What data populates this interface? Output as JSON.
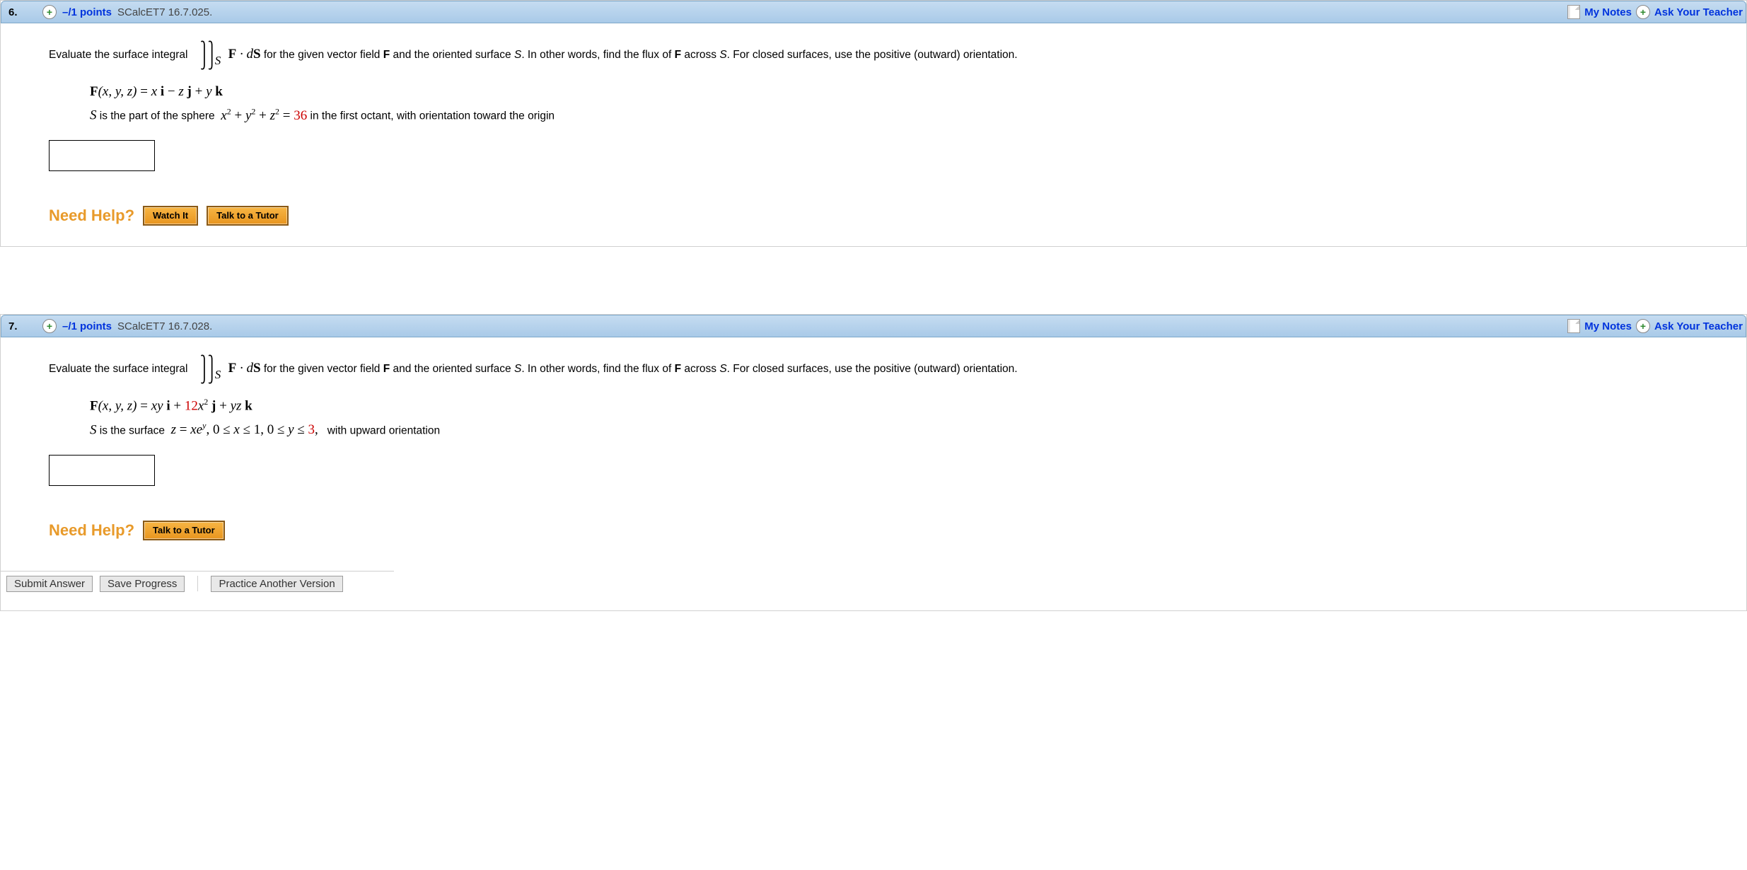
{
  "questions": [
    {
      "num": "6.",
      "points": "–/1 points",
      "source": "SCalcET7 16.7.025.",
      "my_notes": "My Notes",
      "ask": "Ask Your Teacher",
      "text_before_int": "Evaluate the surface integral",
      "int_sub": "S",
      "integrand": "F · dS",
      "text_after_int": " for the given vector field F and the oriented surface S. In other words, find the flux of F across S. For closed surfaces, use the positive (outward) orientation.",
      "vec_line": "F(x, y, z) = x i − z j + y k",
      "surf_prefix": "S is the part of the sphere  ",
      "surf_eq": "x² + y² + z² = ",
      "surf_val": "36",
      "surf_rest": "  in the first octant, with orientation toward the origin",
      "help": "Need Help?",
      "btn_watch": "Watch It",
      "btn_tutor": "Talk to a Tutor"
    },
    {
      "num": "7.",
      "points": "–/1 points",
      "source": "SCalcET7 16.7.028.",
      "my_notes": "My Notes",
      "ask": "Ask Your Teacher",
      "text_before_int": "Evaluate the surface integral",
      "int_sub": "S",
      "integrand": "F · dS",
      "text_after_int": " for the given vector field F and the oriented surface S. In other words, find the flux of F across S. For closed surfaces, use the positive (outward) orientation.",
      "vec_line_pre": "F(x, y, z) = xy i + ",
      "vec_line_red": "12",
      "vec_line_post": "x² j + yz k",
      "surf_prefix": "S is the surface  ",
      "surf_eq": "z = xeʸ, 0 ≤ x ≤ 1, 0 ≤ y ≤ ",
      "surf_val": "3",
      "surf_rest": ",  with upward orientation",
      "help": "Need Help?",
      "btn_tutor": "Talk to a Tutor",
      "submit": "Submit Answer",
      "save": "Save Progress",
      "practice": "Practice Another Version"
    }
  ]
}
